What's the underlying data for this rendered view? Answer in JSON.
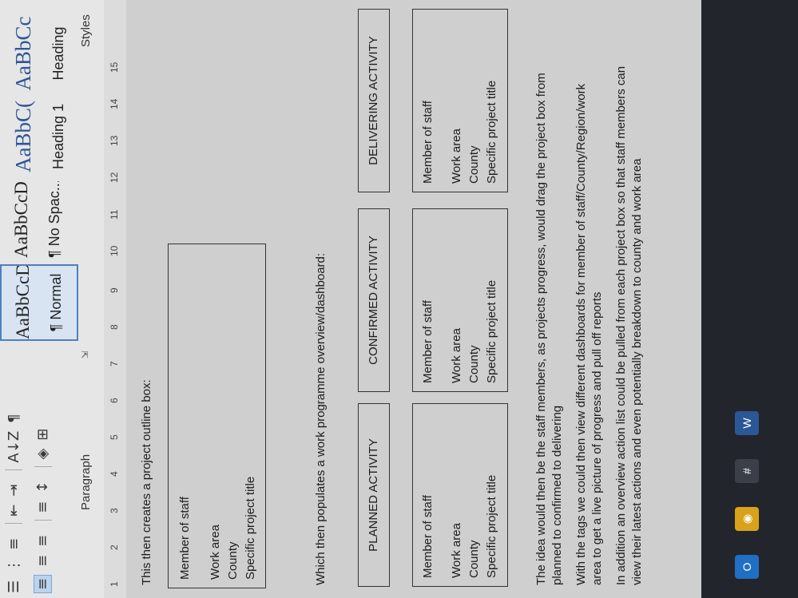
{
  "ribbon": {
    "row1_icons": [
      {
        "name": "bullets-icon",
        "glyph": "☰"
      },
      {
        "name": "numbering-icon",
        "glyph": "⋮"
      },
      {
        "name": "multilevel-list-icon",
        "glyph": "≡"
      },
      {
        "name": "decrease-indent-icon",
        "glyph": "⇤"
      },
      {
        "name": "increase-indent-icon",
        "glyph": "⇥"
      },
      {
        "name": "sort-icon",
        "glyph": "A↓Z"
      },
      {
        "name": "pilcrow-icon",
        "glyph": "¶"
      }
    ],
    "row2_icons": [
      {
        "name": "align-left-icon",
        "glyph": "≡"
      },
      {
        "name": "align-center-icon",
        "glyph": "≡"
      },
      {
        "name": "align-right-icon",
        "glyph": "≡"
      },
      {
        "name": "justify-icon",
        "glyph": "≡"
      },
      {
        "name": "line-spacing-icon",
        "glyph": "↕"
      },
      {
        "name": "shading-icon",
        "glyph": "◈"
      },
      {
        "name": "borders-icon",
        "glyph": "⊞"
      }
    ],
    "paragraph_label": "Paragraph",
    "styles_label": "Styles",
    "style_tiles": [
      {
        "sample": "AaBbCcDd",
        "name": "¶ Normal",
        "heading": false,
        "selected": true
      },
      {
        "sample": "AaBbCcDd",
        "name": "¶ No Spac...",
        "heading": false,
        "selected": false
      },
      {
        "sample": "AaBbC(",
        "name": "Heading 1",
        "heading": true,
        "selected": false
      },
      {
        "sample": "AaBbCc",
        "name": "Heading",
        "heading": true,
        "selected": false
      }
    ]
  },
  "ruler": {
    "numbers": [
      "1",
      "2",
      "3",
      "4",
      "5",
      "6",
      "7",
      "8",
      "9",
      "10",
      "11",
      "12",
      "13",
      "14",
      "15"
    ]
  },
  "document": {
    "intro": "This then creates a project outline box:",
    "outline_box": {
      "member": "Member of staff",
      "work_area": "Work area",
      "county": "County",
      "project_title": "Specific project title"
    },
    "dashboard_intro": "Which then populates a work programme overview/dashboard:",
    "stages": [
      "PLANNED ACTIVITY",
      "CONFIRMED ACTIVITY",
      "DELIVERING ACTIVITY"
    ],
    "stage_card": {
      "member": "Member of staff",
      "work_area": "Work area",
      "county": "County",
      "project_title": "Specific project title"
    },
    "paragraphs": [
      [
        "The idea would then be the staff members, as projects progress, would drag the project box from",
        "planned to confirmed to delivering"
      ],
      [
        "With the tags we could then view different dashboards for member of staff/County/Region/work",
        "area to get a live picture of progress and pull off reports"
      ],
      [
        "In addition an overview action list could be pulled from each project box so that staff members can",
        "view their latest actions and even potentially breakdown to county and work area"
      ]
    ]
  },
  "taskbar": {
    "apps": [
      {
        "name": "outlook-icon",
        "label": "O",
        "color": "#1f6fc5"
      },
      {
        "name": "chrome-icon",
        "label": "◉",
        "color": "#d9a21b"
      },
      {
        "name": "slack-icon",
        "label": "#",
        "color": "#3b3f48"
      },
      {
        "name": "word-icon",
        "label": "W",
        "color": "#2b5797"
      }
    ]
  }
}
